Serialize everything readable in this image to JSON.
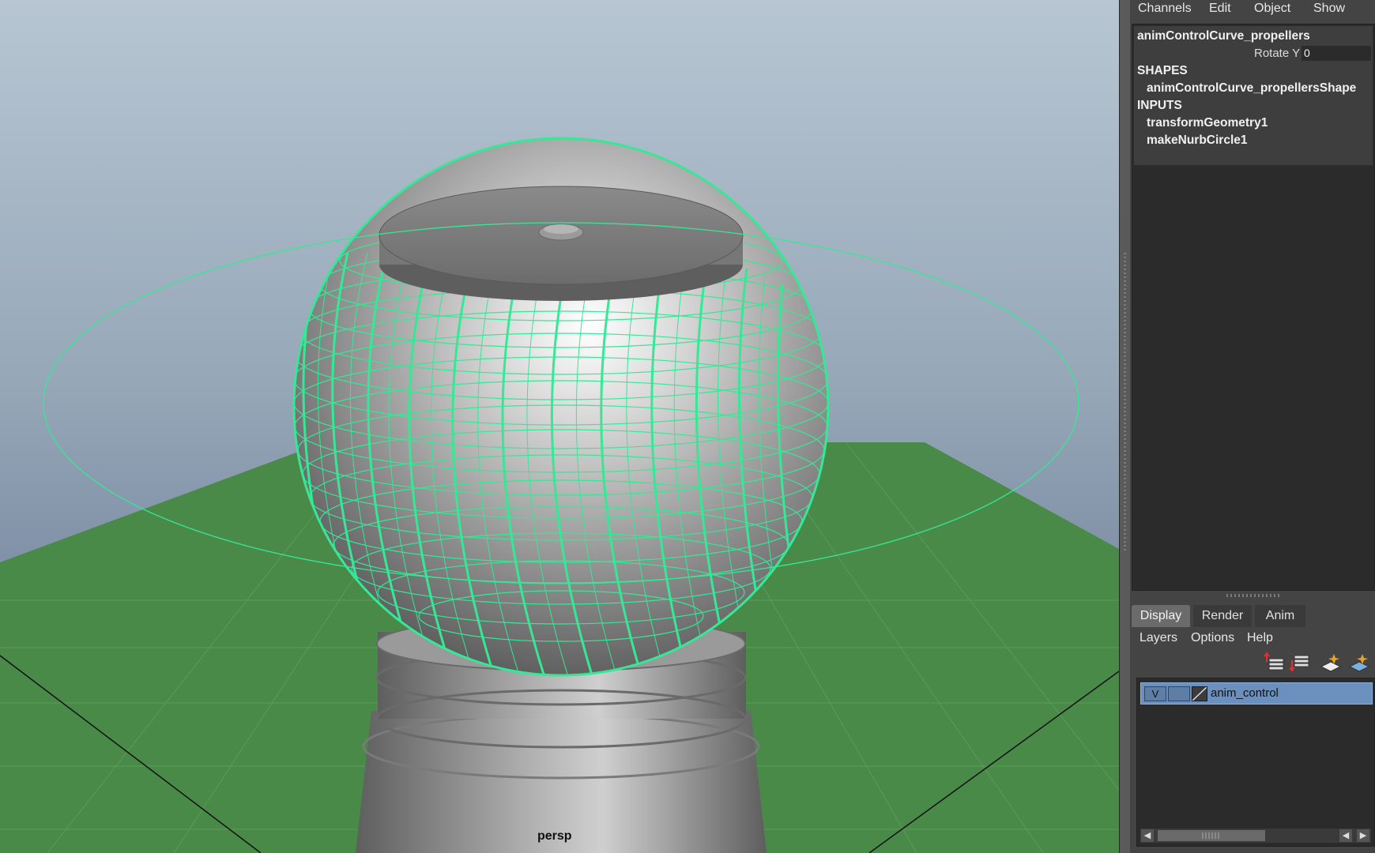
{
  "viewport": {
    "camera_label": "persp"
  },
  "channel_box": {
    "menu": [
      "Channels",
      "Edit",
      "Object",
      "Show"
    ],
    "object_name": "animControlCurve_propellers",
    "attributes": [
      {
        "label": "Rotate Y",
        "value": "0"
      }
    ],
    "shapes_header": "SHAPES",
    "shapes": [
      "animControlCurve_propellersShape"
    ],
    "inputs_header": "INPUTS",
    "inputs": [
      "transformGeometry1",
      "makeNurbCircle1"
    ]
  },
  "layer_editor": {
    "tabs": [
      "Display",
      "Render",
      "Anim"
    ],
    "active_tab": "Display",
    "menu": [
      "Layers",
      "Options",
      "Help"
    ],
    "toolbar_icons": [
      "move-layer-up-icon",
      "move-layer-down-icon",
      "new-layer-icon",
      "new-layer-from-selected-icon"
    ],
    "layers": [
      {
        "visibility": "V",
        "type": "",
        "name": "anim_control",
        "selected": true
      }
    ]
  },
  "colors": {
    "selection_wireframe": "#35e895",
    "ground": "#4a8a49",
    "selected_layer": "#6b90bd"
  }
}
